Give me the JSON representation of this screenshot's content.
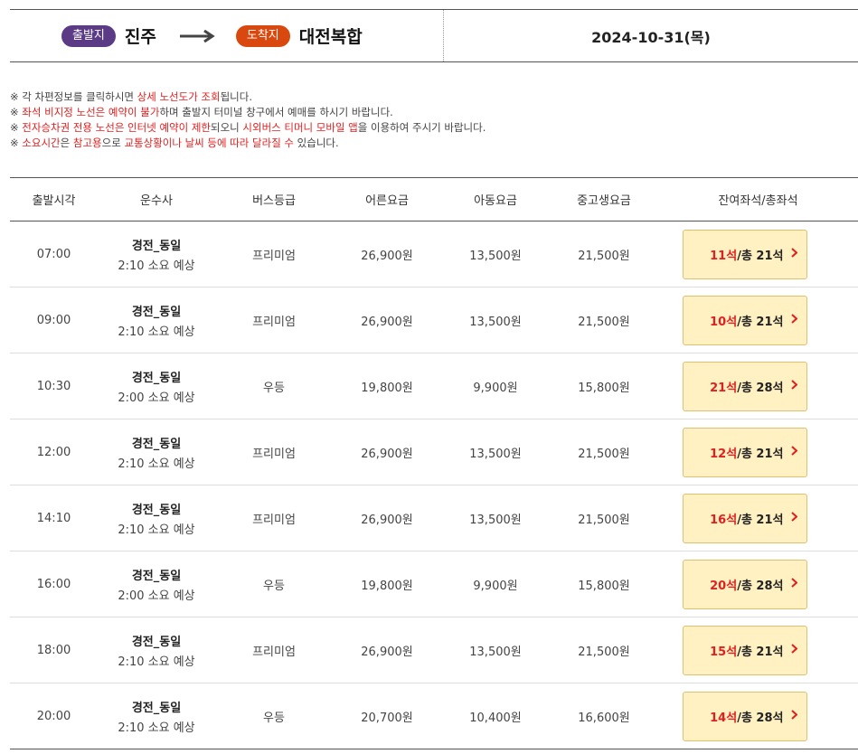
{
  "route": {
    "departure_badge": "출발지",
    "departure_city": "진주",
    "arrival_badge": "도착지",
    "arrival_city": "대전복합",
    "date": "2024-10-31(목)"
  },
  "notices": [
    [
      {
        "t": "※ 각 차편정보를 클릭하시면 "
      },
      {
        "t": "상세 노선도가 조회",
        "red": true
      },
      {
        "t": "됩니다."
      }
    ],
    [
      {
        "t": "※ "
      },
      {
        "t": "좌석 비지정 노선은 예약이 불가",
        "red": true
      },
      {
        "t": "하며 출발지 터미널 창구에서 예매를 하시기 바랍니다."
      }
    ],
    [
      {
        "t": "※ "
      },
      {
        "t": "전자승차권 전용 노선은 인터넷 예약이 제한",
        "red": true
      },
      {
        "t": "되오니 "
      },
      {
        "t": "시외버스 티머니 모바일 앱",
        "red": true
      },
      {
        "t": "을 이용하여 주시기 바랍니다."
      }
    ],
    [
      {
        "t": "※ "
      },
      {
        "t": "소요시간",
        "red": true
      },
      {
        "t": "은 "
      },
      {
        "t": "참고용",
        "red": true
      },
      {
        "t": "으로 "
      },
      {
        "t": "교통상황이나 날씨 등에 따라 달라질 수",
        "red": true
      },
      {
        "t": " 있습니다."
      }
    ]
  ],
  "table": {
    "headers": [
      "출발시각",
      "운수사",
      "버스등급",
      "어른요금",
      "아동요금",
      "중고생요금",
      "잔여좌석/총좌석"
    ],
    "rows": [
      {
        "time": "07:00",
        "company": "경전_동일",
        "duration": "2:10 소요 예상",
        "grade": "프리미엄",
        "adult": "26,900원",
        "child": "13,500원",
        "youth": "21,500원",
        "remain": "11석",
        "total": " /총 21석"
      },
      {
        "time": "09:00",
        "company": "경전_동일",
        "duration": "2:10 소요 예상",
        "grade": "프리미엄",
        "adult": "26,900원",
        "child": "13,500원",
        "youth": "21,500원",
        "remain": "10석",
        "total": " /총 21석"
      },
      {
        "time": "10:30",
        "company": "경전_동일",
        "duration": "2:00 소요 예상",
        "grade": "우등",
        "adult": "19,800원",
        "child": "9,900원",
        "youth": "15,800원",
        "remain": "21석",
        "total": " /총 28석"
      },
      {
        "time": "12:00",
        "company": "경전_동일",
        "duration": "2:10 소요 예상",
        "grade": "프리미엄",
        "adult": "26,900원",
        "child": "13,500원",
        "youth": "21,500원",
        "remain": "12석",
        "total": " /총 21석"
      },
      {
        "time": "14:10",
        "company": "경전_동일",
        "duration": "2:10 소요 예상",
        "grade": "프리미엄",
        "adult": "26,900원",
        "child": "13,500원",
        "youth": "21,500원",
        "remain": "16석",
        "total": " /총 21석"
      },
      {
        "time": "16:00",
        "company": "경전_동일",
        "duration": "2:00 소요 예상",
        "grade": "우등",
        "adult": "19,800원",
        "child": "9,900원",
        "youth": "15,800원",
        "remain": "20석",
        "total": " /총 28석"
      },
      {
        "time": "18:00",
        "company": "경전_동일",
        "duration": "2:10 소요 예상",
        "grade": "프리미엄",
        "adult": "26,900원",
        "child": "13,500원",
        "youth": "21,500원",
        "remain": "15석",
        "total": " /총 21석"
      },
      {
        "time": "20:00",
        "company": "경전_동일",
        "duration": "2:10 소요 예상",
        "grade": "우등",
        "adult": "20,700원",
        "child": "10,400원",
        "youth": "16,600원",
        "remain": "14석",
        "total": " /총 28석"
      }
    ]
  },
  "colors": {
    "departure_badge": "#5b3a86",
    "arrival_badge": "#d9480f",
    "highlight_red": "#e02020",
    "seat_button_bg": "#fff1c2"
  },
  "icons": {
    "route_arrow": "arrow-right-icon",
    "seat_chevron": "chevron-right-icon"
  }
}
